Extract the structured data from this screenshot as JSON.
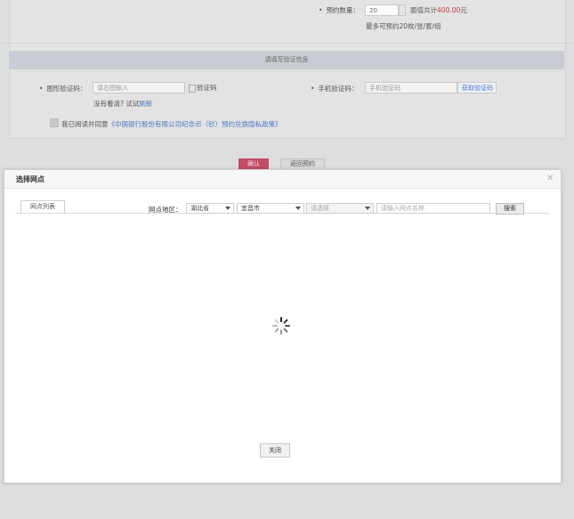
{
  "booking": {
    "quantity_label": "预约数量：",
    "quantity_value": "20",
    "total_prefix": "面值共计",
    "total_amount": "400.00",
    "total_suffix": "元",
    "max_note": "最多可预约20枚/张/套/组"
  },
  "verify": {
    "section_title": "请填写验证信息",
    "img_code_label": "图形验证码：",
    "img_code_placeholder": "请右图输入",
    "img_code_alt": "验证码",
    "hint_prefix": "没有看清?  试试",
    "refresh_link": "刷新",
    "sms_label": "手机验证码：",
    "sms_placeholder": "手机验证码",
    "get_sms_button": "获取验证码",
    "agree_prefix": "我已阅读并同意",
    "agree_link": "《中国银行股份有限公司纪念币（钞）预约兑换隐私政策》"
  },
  "actions": {
    "confirm": "确认",
    "back": "返回预约"
  },
  "modal": {
    "title": "选择网点",
    "close_icon": "close-icon",
    "tab_label": "网点列表",
    "region_label": "网点地区：",
    "province": "湖北省",
    "city": "宜昌市",
    "district_placeholder": "请选择",
    "search_placeholder": "请输入网点名称",
    "search_button": "搜索",
    "close_button": "关闭"
  },
  "colors": {
    "accent": "#c24b67",
    "link": "#4a78c0",
    "price": "#c03a3a"
  }
}
